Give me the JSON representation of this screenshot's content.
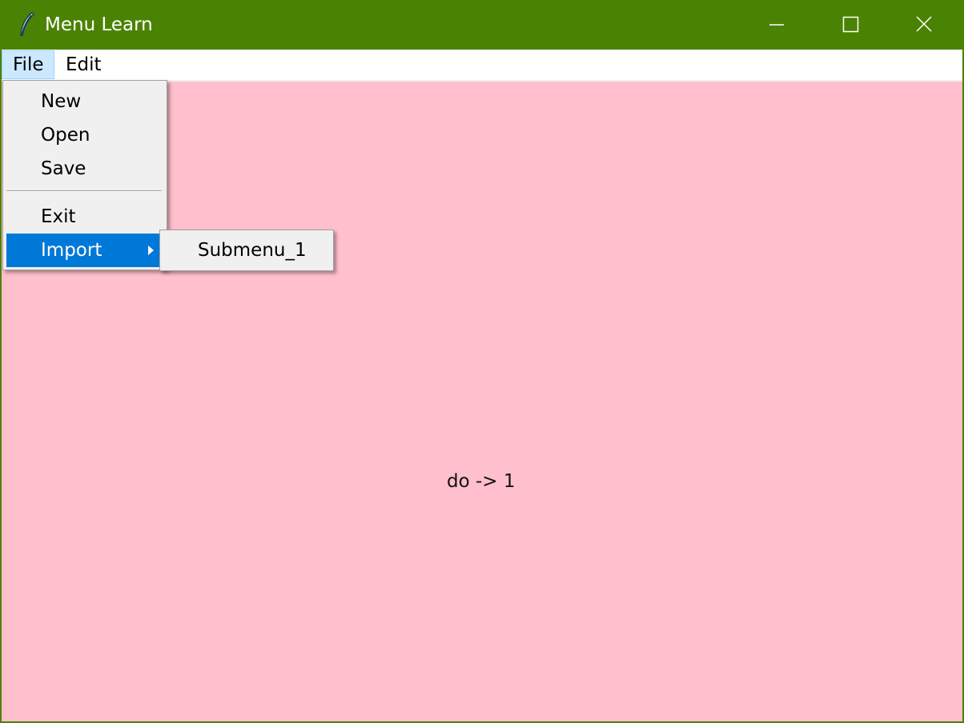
{
  "window": {
    "title": "Menu Learn",
    "title_bar_color": "#4a8303",
    "app_icon": "feather-icon",
    "controls": {
      "minimize_icon": "minimize-icon",
      "maximize_icon": "maximize-icon",
      "close_icon": "close-icon"
    }
  },
  "menubar": {
    "items": [
      {
        "label": "File",
        "state": "open"
      },
      {
        "label": "Edit",
        "state": "normal"
      }
    ]
  },
  "file_menu": {
    "items": [
      {
        "label": "New"
      },
      {
        "label": "Open"
      },
      {
        "label": "Save"
      },
      {
        "label": "Exit"
      },
      {
        "label": "Import",
        "highlighted": true,
        "has_submenu": true
      }
    ],
    "highlight_color": "#0078d7"
  },
  "import_submenu": {
    "items": [
      {
        "label": "Submenu_1"
      }
    ]
  },
  "content": {
    "background_color": "#ffbfcc",
    "status_text": "do -> 1"
  }
}
